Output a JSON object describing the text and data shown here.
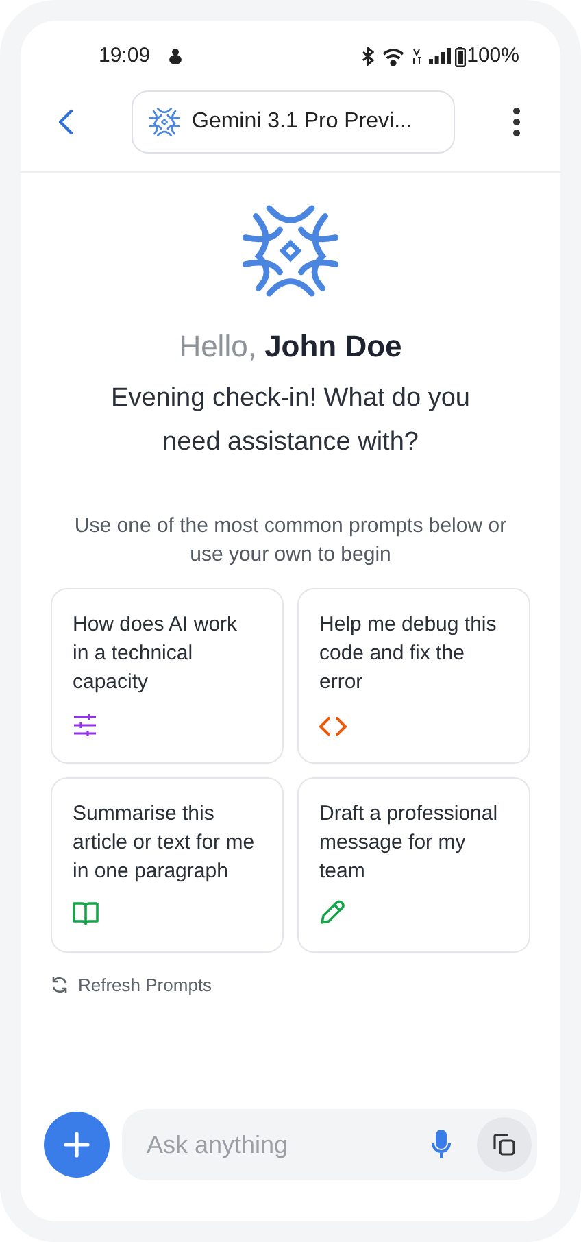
{
  "status_bar": {
    "time": "19:09",
    "battery": "100%"
  },
  "header": {
    "model": "Gemini 3.1 Pro Previ..."
  },
  "greeting": {
    "prefix": "Hello,",
    "name": "John Doe"
  },
  "question": "Evening check-in! What do you need assistance with?",
  "hint": "Use one of the most common prompts below or use your own to begin",
  "prompts": [
    {
      "text": "How does AI work in a technical capacity",
      "color": "#9333ea"
    },
    {
      "text": "Help me debug this code and fix the error",
      "color": "#ea580c"
    },
    {
      "text": "Summarise this article or text for me in one paragraph",
      "color": "#16a34a"
    },
    {
      "text": "Draft a professional message for my team",
      "color": "#16a34a"
    }
  ],
  "refresh": "Refresh Prompts",
  "composer": {
    "placeholder": "Ask anything"
  }
}
